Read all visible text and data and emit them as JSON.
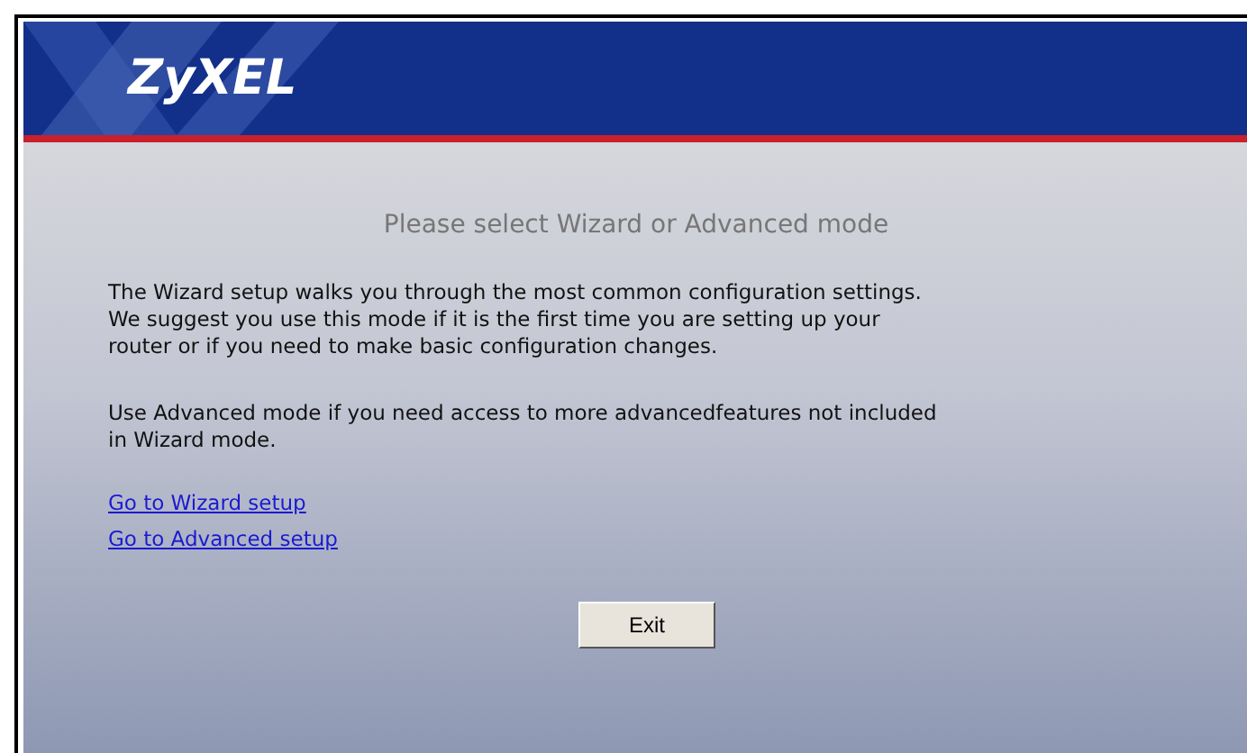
{
  "header": {
    "logo": "ZyXEL"
  },
  "title": "Please select Wizard or Advanced mode",
  "paragraphs": [
    "The Wizard setup walks you through the most common configuration settings.\nWe suggest you use this mode if it is the first time you are setting up your\nrouter or if you need to make basic configuration changes.",
    "Use Advanced mode if you need access to more advancedfeatures not included\nin Wizard mode."
  ],
  "links": [
    "Go to Wizard setup",
    "Go to Advanced setup"
  ],
  "buttons": [
    "Exit"
  ]
}
